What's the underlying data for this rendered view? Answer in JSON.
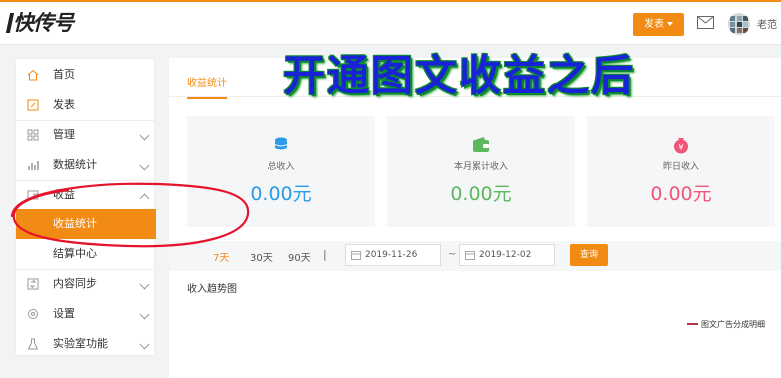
{
  "header": {
    "logo_text": "快传号",
    "publish_label": "发表",
    "username": "老范"
  },
  "sidebar": {
    "items": [
      {
        "label": "首页",
        "icon": "home-icon"
      },
      {
        "label": "发表",
        "icon": "edit-icon"
      },
      {
        "label": "管理",
        "icon": "grid-icon"
      },
      {
        "label": "数据统计",
        "icon": "bar-chart-icon"
      },
      {
        "label": "收益",
        "icon": "wallet-icon"
      },
      {
        "label": "收益统计",
        "active": true
      },
      {
        "label": "结算中心"
      },
      {
        "label": "内容同步",
        "icon": "sync-icon"
      },
      {
        "label": "设置",
        "icon": "gear-icon"
      },
      {
        "label": "实验室功能",
        "icon": "lab-icon"
      }
    ]
  },
  "main": {
    "tab_label": "收益统计",
    "cards": [
      {
        "label": "总收入",
        "value": "0.00元",
        "color": "#2b9be6",
        "icon": "coins-icon"
      },
      {
        "label": "本月累计收入",
        "value": "0.00元",
        "color": "#5cb85c",
        "icon": "wallet-icon"
      },
      {
        "label": "昨日收入",
        "value": "0.00元",
        "color": "#f2557a",
        "icon": "money-bag-icon"
      }
    ],
    "ranges": [
      "7天",
      "30天",
      "90天"
    ],
    "separator": "|",
    "start_date": "2019-11-26",
    "end_date": "2019-12-02",
    "tilde": "~",
    "query_label": "查询",
    "trend_title": "收入趋势图",
    "legend_label": "图文广告分成明细"
  },
  "overlay": {
    "title": "开通图文收益之后"
  },
  "colors": {
    "accent": "#f28b13",
    "overlay_text": "#1a22d8",
    "annotation": "#e5142d"
  }
}
